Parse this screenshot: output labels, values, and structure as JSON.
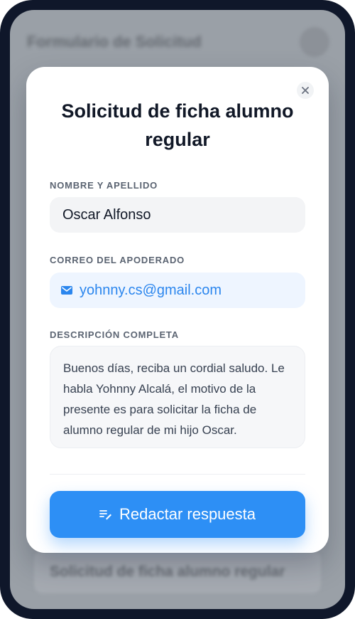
{
  "background": {
    "title": "Formulario de Solicitud",
    "card_text": "Solicitud de ficha alumno regular"
  },
  "modal": {
    "title": "Solicitud de ficha alumno regular",
    "close_icon": "close-icon",
    "name_label": "NOMBRE Y APELLIDO",
    "name_value": "Oscar Alfonso",
    "email_label": "CORREO DEL APODERADO",
    "email_icon": "mail-icon",
    "email_value": "yohnny.cs@gmail.com",
    "description_label": "DESCRIPCIÓN COMPLETA",
    "description_value": "Buenos días, reciba un cordial saludo. Le habla Yohnny Alcalá, el motivo de la presente es para solicitar la ficha de alumno regular de mi hijo Oscar.",
    "reply_icon": "compose-icon",
    "reply_button_label": "Redactar respuesta"
  },
  "colors": {
    "accent": "#2d8ff5",
    "email_text": "#2b86ee",
    "title": "#111827"
  }
}
